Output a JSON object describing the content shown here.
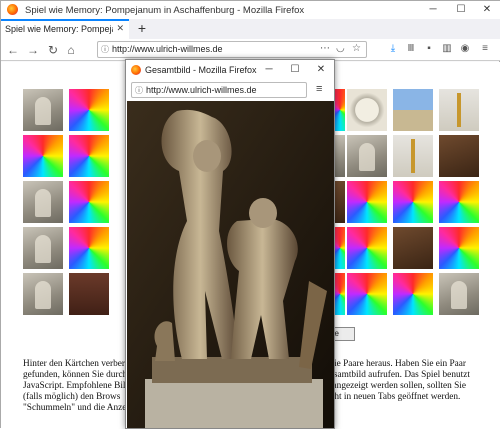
{
  "browser": {
    "window_title": "Spiel wie Memory: Pompejanum in Aschaffenburg - Mozilla Firefox",
    "tab_title": "Spiel wie Memory: Pompejanum in A",
    "url": "http://www.ulrich-willmes.de"
  },
  "popup": {
    "window_title": "Gesamtbild - Mozilla Firefox",
    "url": "http://www.ulrich-willmes.de"
  },
  "page": {
    "button_fragment": "ge",
    "text_left": [
      "Hinter den Kärtchen verber",
      "gefunden, können Sie durch",
      "JavaScript. Empfohlene Bil",
      "(falls möglich) den Brows",
      "\"Schummeln\" und die Anzei"
    ],
    "text_right": [
      "e die Paare heraus. Haben Sie ein Paar",
      "Gesamtbild aufrufen. Das Spiel benutzt",
      "er angezeigt werden sollen, sollten Sie",
      "nicht in neuen Tabs geöffnet werden.",
      "ser."
    ]
  },
  "colors": {
    "accent": "#0a84ff"
  }
}
